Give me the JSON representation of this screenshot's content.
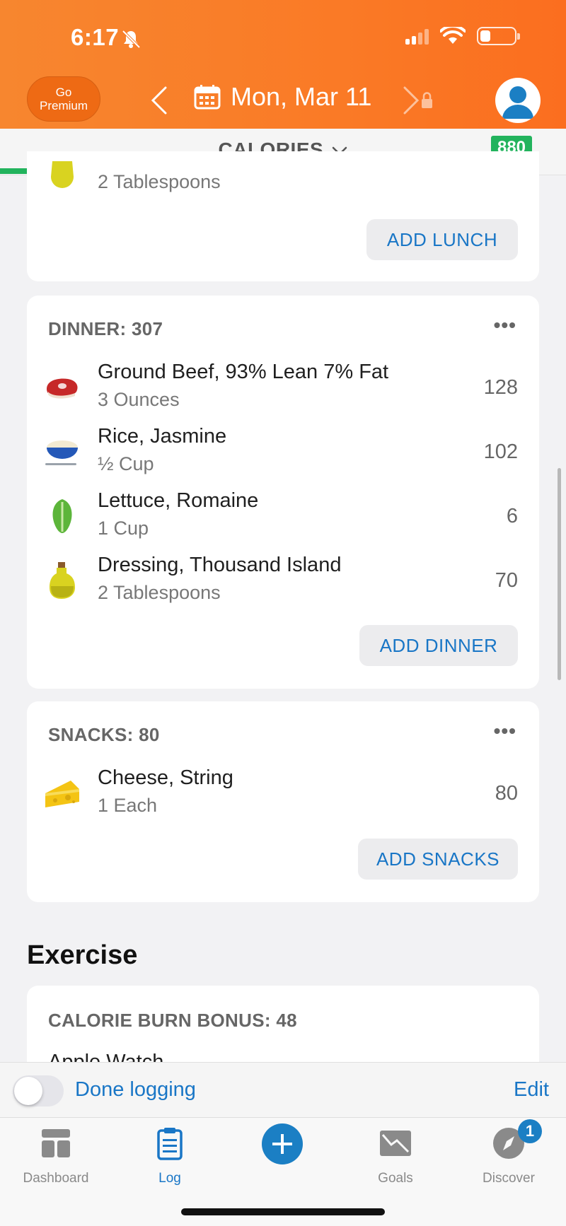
{
  "status_bar": {
    "time": "6:17"
  },
  "header": {
    "premium_line1": "Go",
    "premium_line2": "Premium",
    "date": "Mon, Mar 11"
  },
  "calories_bar": {
    "title": "CALORIES",
    "remaining": "880",
    "progress_fraction": 0.36,
    "colors": {
      "progress": "#22b35d",
      "accent": "#fa7a26"
    }
  },
  "lunch": {
    "partial_item_qty": "2 Tablespoons",
    "add_label": "ADD LUNCH"
  },
  "dinner": {
    "title": "DINNER: 307",
    "more": "•••",
    "items": [
      {
        "name": "Ground Beef, 93% Lean 7% Fat",
        "qty": "3 Ounces",
        "cal": "128",
        "icon": "steak-icon"
      },
      {
        "name": "Rice, Jasmine",
        "qty": "½ Cup",
        "cal": "102",
        "icon": "rice-bowl-icon"
      },
      {
        "name": "Lettuce, Romaine",
        "qty": "1 Cup",
        "cal": "6",
        "icon": "lettuce-icon"
      },
      {
        "name": "Dressing, Thousand Island",
        "qty": "2 Tablespoons",
        "cal": "70",
        "icon": "oil-bottle-icon"
      }
    ],
    "add_label": "ADD DINNER"
  },
  "snacks": {
    "title": "SNACKS: 80",
    "more": "•••",
    "items": [
      {
        "name": "Cheese, String",
        "qty": "1 Each",
        "cal": "80",
        "icon": "cheese-icon"
      }
    ],
    "add_label": "ADD SNACKS"
  },
  "exercise": {
    "heading": "Exercise",
    "card_title": "CALORIE BURN BONUS: 48",
    "partial_item": "Apple Watch"
  },
  "done_bar": {
    "label": "Done logging",
    "edit": "Edit"
  },
  "tabs": [
    {
      "label": "Dashboard",
      "icon": "dashboard-icon"
    },
    {
      "label": "Log",
      "icon": "clipboard-icon"
    },
    {
      "label": "",
      "icon": "plus-icon"
    },
    {
      "label": "Goals",
      "icon": "goals-icon"
    },
    {
      "label": "Discover",
      "icon": "compass-icon",
      "badge": "1"
    }
  ]
}
